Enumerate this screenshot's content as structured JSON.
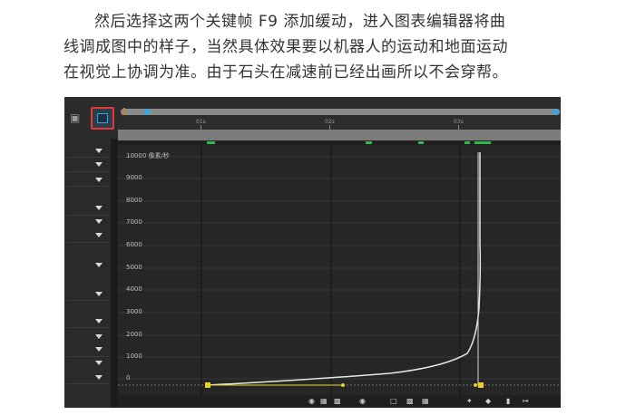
{
  "paragraph": {
    "line1": "然后选择这两个关键帧 F9 添加缓动，进入图表编辑器将曲",
    "line2": "线调成图中的样子，当然具体效果要以机器人的运动和地面运动",
    "line3": "在视觉上协调为准。由于石头在减速前已经出画所以不会穿帮。"
  },
  "timeline": {
    "ruler_labels": [
      "01s",
      "02s",
      "03s"
    ],
    "graph_editor_button": "graph-editor-icon",
    "layer_icon": "layers-icon"
  },
  "graph": {
    "unit_label": "10000 像素/秒",
    "y_labels": [
      "9000",
      "8000",
      "7000",
      "6000",
      "5000",
      "4000",
      "3000",
      "2000",
      "1000",
      "0"
    ]
  },
  "colors": {
    "panel_bg": "#232323",
    "graph_bg": "#262626",
    "highlight_box": "#e03a3a",
    "keyframe_yellow": "#e8d12a",
    "keyframe_green": "#2db84a",
    "time_marker": "#3aa8e0",
    "curve": "#e6e6e6"
  }
}
